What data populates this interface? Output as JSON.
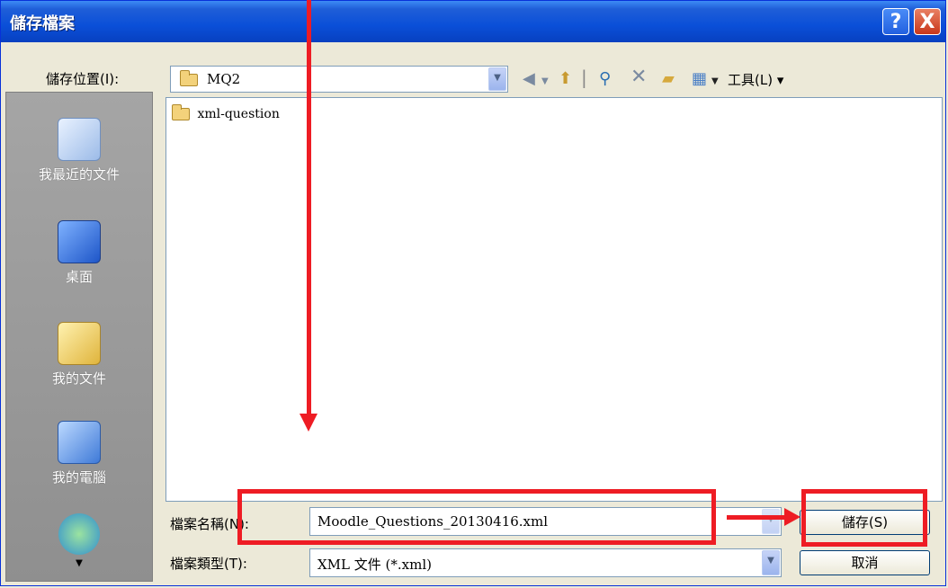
{
  "dialog": {
    "title": "儲存檔案"
  },
  "titlebar": {
    "help": "?",
    "close": "X"
  },
  "location": {
    "label": "儲存位置(I):",
    "value": "MQ2",
    "tools_label": "工具(L)"
  },
  "places": [
    {
      "label": "我最近的文件",
      "icon": "recent-documents-icon"
    },
    {
      "label": "桌面",
      "icon": "desktop-icon"
    },
    {
      "label": "我的文件",
      "icon": "my-documents-icon"
    },
    {
      "label": "我的電腦",
      "icon": "my-computer-icon"
    },
    {
      "label": "",
      "icon": "network-icon"
    }
  ],
  "files": [
    {
      "name": "xml-question"
    }
  ],
  "filename": {
    "label": "檔案名稱(N):",
    "value": "Moodle_Questions_20130416.xml"
  },
  "filetype": {
    "label": "檔案類型(T):",
    "value": "XML 文件 (*.xml)"
  },
  "buttons": {
    "save": "儲存(S)",
    "cancel": "取消"
  }
}
